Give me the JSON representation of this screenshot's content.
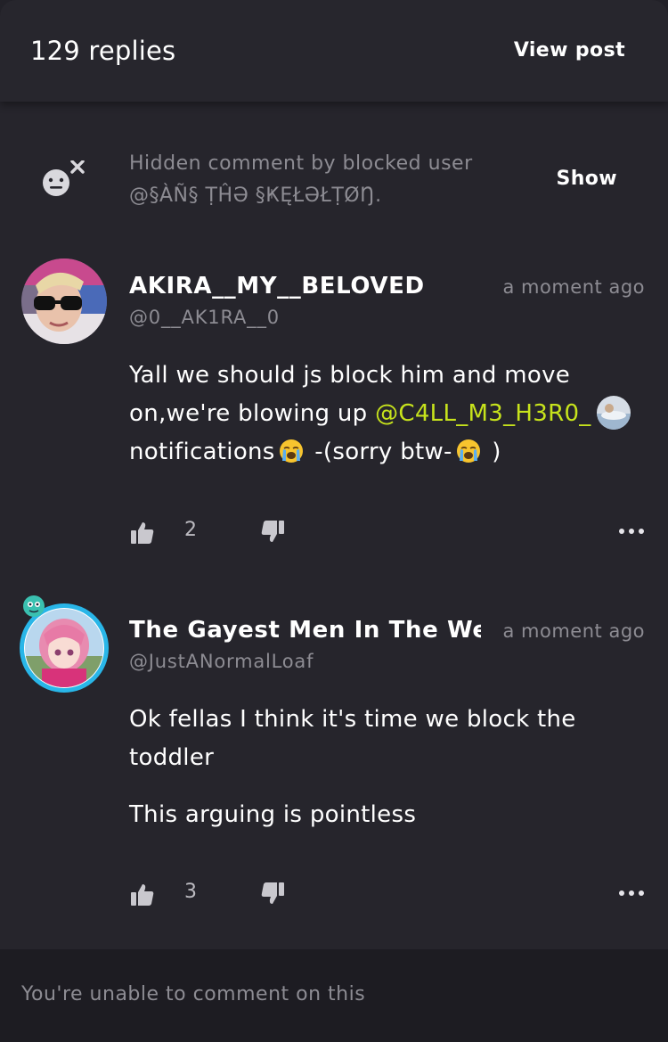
{
  "header": {
    "replies_count": "129 replies",
    "view_post_label": "View post"
  },
  "hidden_comment": {
    "text_line1": "Hidden comment by blocked user",
    "text_line2": "@§ÀÑ§ ṬĤƏ §ҜĘŁƏŁṬØŊ.",
    "show_label": "Show"
  },
  "comments": [
    {
      "author": "AKIRA__MY__BELOVED",
      "handle": "@0__AK1RA__0",
      "time": "a moment ago",
      "text_before_mention": "Yall we should js block him and move on,we're blowing up ",
      "mention": "@C4LL_M3_H3R0_",
      "text_after_mention": "notifications",
      "text_tail_1": " -(sorry btw-",
      "text_tail_2": " )",
      "likes": "2"
    },
    {
      "author": "The Gayest Men In The West",
      "handle": "@JustANormalLoaf",
      "time": "a moment ago",
      "paragraphs": [
        "Ok fellas I think it's time we block the toddler",
        "This arguing is pointless"
      ],
      "likes": "3"
    }
  ],
  "footer": {
    "message": "You're unable to comment on this"
  },
  "icons": {
    "blocked_user": "blocked-user-icon",
    "like": "thumbs-up-icon",
    "dislike": "thumbs-down-icon",
    "more": "more-dots-icon",
    "crying_emoji": "crying-face-emoji"
  },
  "colors": {
    "background": "#26252c",
    "mention": "#c7e31c",
    "muted_text": "#8d8c93",
    "avatar_ring": "#29b6e8"
  }
}
